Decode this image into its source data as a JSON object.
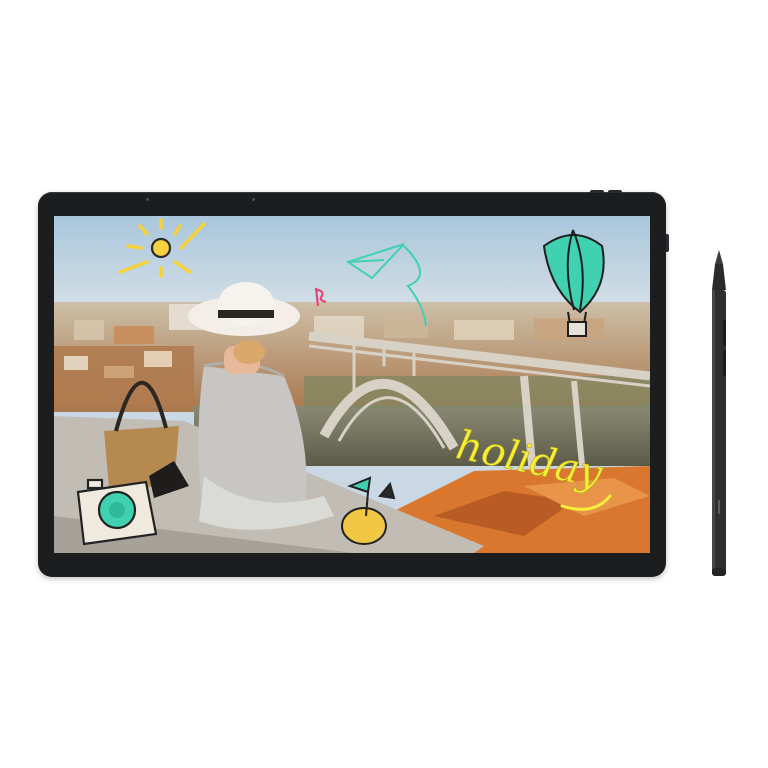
{
  "scene": {
    "doodle_text": "holiday",
    "colors": {
      "background": "#ffffff",
      "tablet_frame": "#1c1d1f",
      "sky_top": "#a9c6dc",
      "sky_bottom": "#e4e9ea",
      "river": "#6b6a55",
      "bridge": "#d8d2c6",
      "rooftops": "#d9772f",
      "doodle_yellow": "#f6ef3a",
      "doodle_teal": "#3fd1b0",
      "doodle_pink": "#e8447a",
      "stylus": "#2e2f31"
    },
    "icons": [
      "sun-doodle-icon",
      "paper-plane-doodle-icon",
      "hot-air-balloon-doodle-icon",
      "camera-doodle-icon",
      "coconut-drink-doodle-icon",
      "basket-bag-icon"
    ]
  }
}
